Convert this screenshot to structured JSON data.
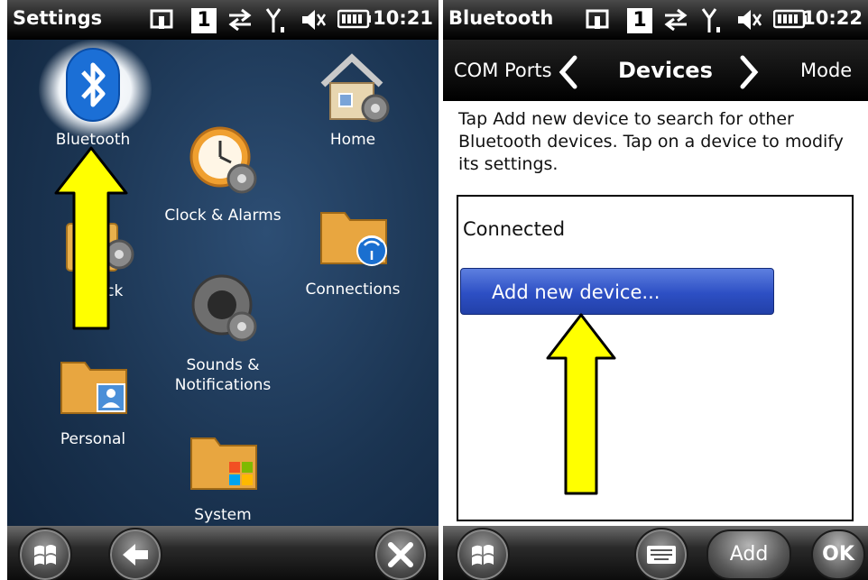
{
  "left": {
    "status": {
      "title": "Settings",
      "sim": "1",
      "time": "10:21"
    },
    "tiles": {
      "bluetooth": "Bluetooth",
      "home": "Home",
      "clock": "Clock & Alarms",
      "lock": "Lock",
      "connections": "Connections",
      "sounds_line1": "Sounds &",
      "sounds_line2": "Notifications",
      "personal": "Personal",
      "system": "System"
    },
    "icons": [
      "windows-start-icon",
      "back-arrow-icon",
      "close-icon"
    ]
  },
  "right": {
    "status": {
      "title": "Bluetooth",
      "sim": "1",
      "time": "10:22"
    },
    "tabs": {
      "prev": "COM Ports",
      "current": "Devices",
      "next": "Mode"
    },
    "instructions": "Tap Add new device to search for other Bluetooth devices. Tap on a device to modify its settings.",
    "list": {
      "connected": "Connected",
      "add_device": "Add new device..."
    },
    "bottom": {
      "add": "Add",
      "ok": "OK"
    }
  },
  "colors": {
    "arrow": "#ffff00",
    "accent": "#2f55c8"
  }
}
